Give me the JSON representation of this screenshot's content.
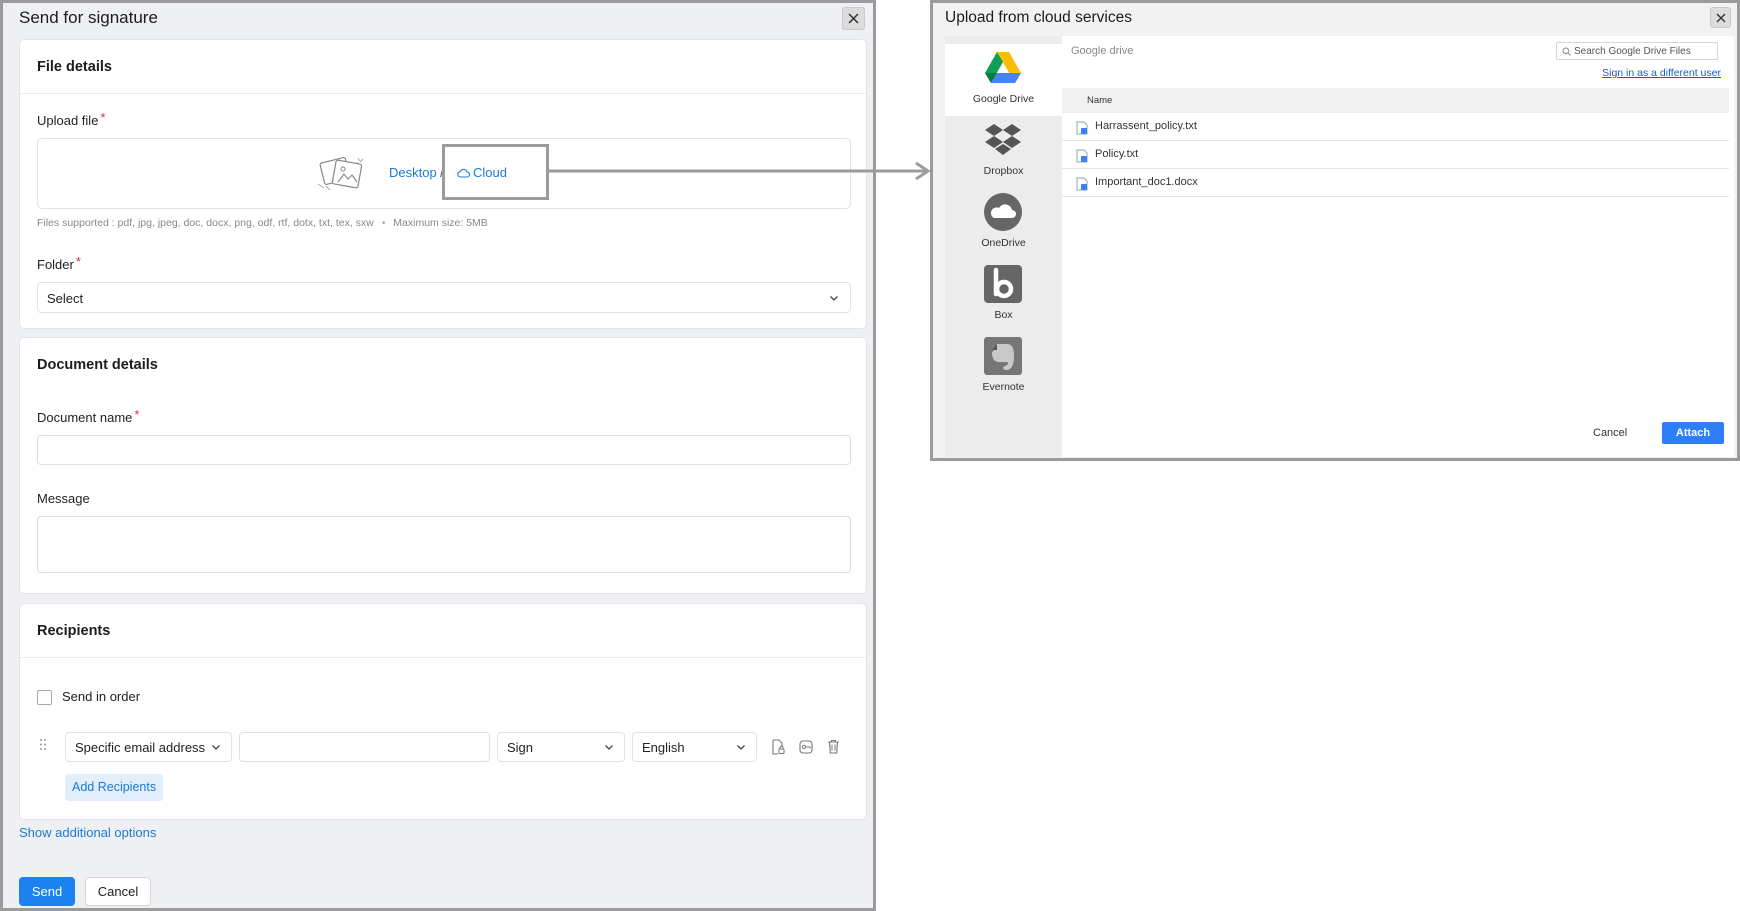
{
  "send_dialog": {
    "title": "Send for signature",
    "file_details": {
      "heading": "File details",
      "upload_label": "Upload file",
      "desktop_link": "Desktop",
      "separator": "/",
      "cloud_link": "Cloud",
      "files_supported": "Files supported : pdf, jpg, jpeg, doc, docx, png, odf, rtf, dotx, txt, tex, sxw",
      "bullet": "•",
      "max_size": "Maximum size: 5MB",
      "folder_label": "Folder",
      "folder_value": "Select",
      "required_mark": "*"
    },
    "document_details": {
      "heading": "Document details",
      "name_label": "Document name",
      "name_value": "",
      "message_label": "Message",
      "message_value": ""
    },
    "recipients": {
      "heading": "Recipients",
      "send_in_order": "Send in order",
      "recipient_type": "Specific email address",
      "email_value": "",
      "action": "Sign",
      "language": "English",
      "add_button": "Add Recipients"
    },
    "show_additional": "Show additional options",
    "send_button": "Send",
    "cancel_button": "Cancel"
  },
  "cloud_dialog": {
    "title": "Upload from cloud services",
    "services": [
      {
        "label": "Google Drive",
        "icon": "google-drive-icon"
      },
      {
        "label": "Dropbox",
        "icon": "dropbox-icon"
      },
      {
        "label": "OneDrive",
        "icon": "onedrive-icon"
      },
      {
        "label": "Box",
        "icon": "box-icon"
      },
      {
        "label": "Evernote",
        "icon": "evernote-icon"
      }
    ],
    "source_label": "Google drive",
    "search_placeholder": "Search Google Drive Files",
    "signin_link": "Sign in as a different user",
    "column_name": "Name",
    "files": [
      "Harrassent_policy.txt",
      "Policy.txt",
      "Important_doc1.docx"
    ],
    "cancel_button": "Cancel",
    "attach_button": "Attach"
  },
  "colors": {
    "accent": "#1b82f0",
    "link": "#1a7bd4",
    "attach": "#2d7ff9",
    "required": "#e0322f",
    "highlight_border": "#9b9b9b"
  }
}
